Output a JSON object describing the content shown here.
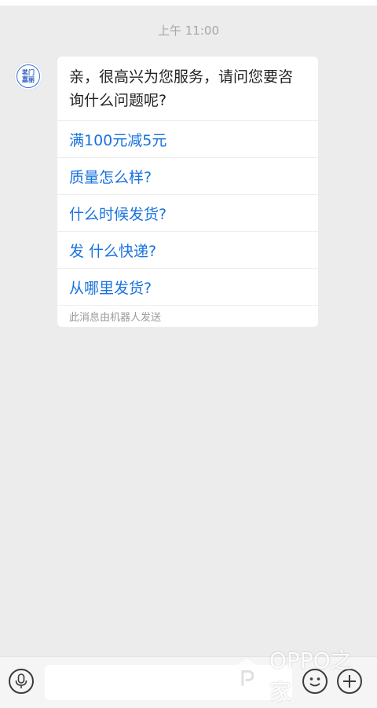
{
  "header": {
    "timestamp": "上午 11:00"
  },
  "bot": {
    "avatar_text_line1": "茗门",
    "avatar_text_line2": "嘉丽",
    "avatar_icon": "shop-logo-icon"
  },
  "message": {
    "greeting": "亲，很高兴为您服务，请问您要咨询什么问题呢?",
    "options": [
      {
        "label": "满100元减5元"
      },
      {
        "label": "质量怎么样?"
      },
      {
        "label": "什么时候发货?"
      },
      {
        "label": "发 什么快递?"
      },
      {
        "label": "从哪里发货?"
      }
    ],
    "footer_note": "此消息由机器人发送"
  },
  "input_bar": {
    "mic_icon": "microphone-icon",
    "input_value": "",
    "emoji_icon": "smiley-icon",
    "plus_icon": "plus-icon"
  },
  "watermark": {
    "text": "OPPO之家",
    "icon": "oppo-home-logo-icon"
  },
  "colors": {
    "background": "#ececec",
    "link": "#1a73e0",
    "bubble": "#ffffff"
  }
}
